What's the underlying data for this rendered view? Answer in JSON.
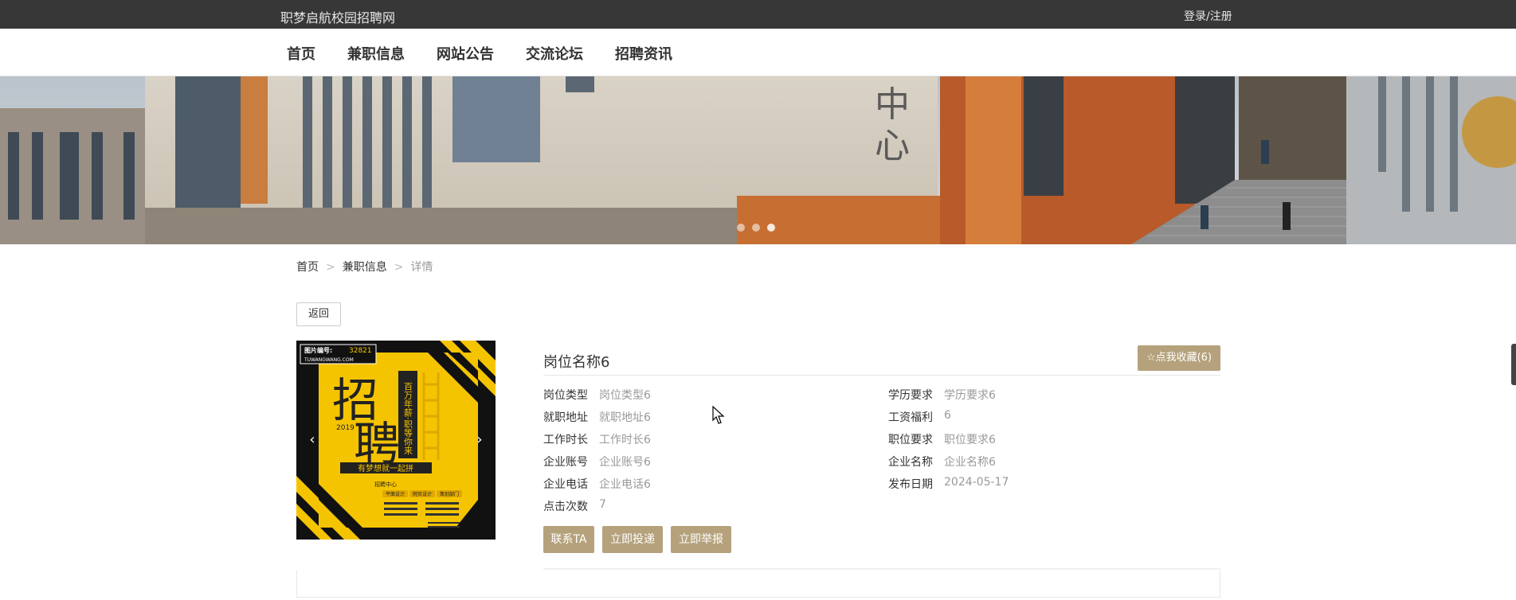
{
  "header": {
    "site_title": "职梦启航校园招聘网",
    "login_label": "登录/注册"
  },
  "nav": {
    "items": [
      "首页",
      "兼职信息",
      "网站公告",
      "交流论坛",
      "招聘资讯"
    ]
  },
  "banner": {
    "slide_count": 3,
    "active_slide": 3,
    "building_sign": "中 心"
  },
  "breadcrumb": {
    "home": "首页",
    "section": "兼职信息",
    "current": "详情",
    "separator": ">"
  },
  "back_label": "返回",
  "poster": {
    "tag_label": "图片编号:",
    "tag_number": "32821",
    "site": "TUWANGWANG.COM",
    "headline_top": "招",
    "headline_bottom": "聘",
    "year": "2019",
    "side_text": "百万年薪·职等你来",
    "slogan": "有梦想就一起拼",
    "section_label": "招聘中心",
    "departments": [
      "平面设计",
      "网页设计",
      "策划部门"
    ]
  },
  "job": {
    "title": "岗位名称6",
    "favorite_label": "点我收藏(6)",
    "left_fields": [
      {
        "label": "岗位类型",
        "value": "岗位类型6"
      },
      {
        "label": "就职地址",
        "value": "就职地址6"
      },
      {
        "label": "工作时长",
        "value": "工作时长6"
      },
      {
        "label": "企业账号",
        "value": "企业账号6"
      },
      {
        "label": "企业电话",
        "value": "企业电话6"
      },
      {
        "label": "点击次数",
        "value": "7"
      }
    ],
    "right_fields": [
      {
        "label": "学历要求",
        "value": "学历要求6"
      },
      {
        "label": "工资福利",
        "value": "6"
      },
      {
        "label": "职位要求",
        "value": "职位要求6"
      },
      {
        "label": "企业名称",
        "value": "企业名称6"
      },
      {
        "label": "发布日期",
        "value": "2024-05-17"
      }
    ],
    "actions": [
      "联系TA",
      "立即投递",
      "立即举报"
    ]
  },
  "colors": {
    "topbar": "#373737",
    "accent": "#b5a27c",
    "poster_yellow": "#f5c400"
  }
}
